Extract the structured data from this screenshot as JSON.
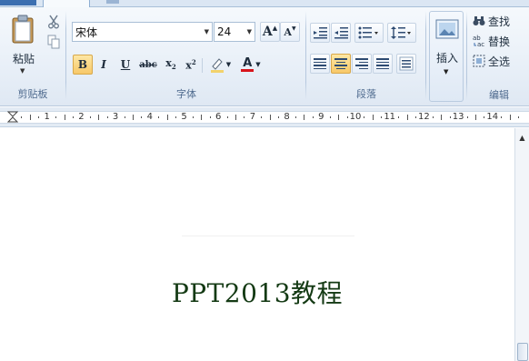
{
  "clipboard": {
    "paste_label": "粘贴",
    "group_label": "剪贴板",
    "icons": [
      "clipboard-icon",
      "scissors-icon",
      "copy-icon"
    ]
  },
  "font": {
    "name_value": "宋体",
    "size_value": "24",
    "grow_label": "A",
    "shrink_label": "A",
    "bold_label": "B",
    "italic_label": "I",
    "underline_label": "U",
    "strike_label": "abc",
    "subscript_label": "x",
    "superscript_label": "x",
    "sub_marker": "2",
    "sup_marker": "2",
    "color_label": "A",
    "group_label": "字体",
    "highlight_color": "#f2d26b",
    "font_color": "#d8141b"
  },
  "paragraph": {
    "group_label": "段落"
  },
  "insert": {
    "label": "插入"
  },
  "editing": {
    "find_label": "查找",
    "replace_label": "替换",
    "select_all_label": "全选",
    "group_label": "编辑"
  },
  "ruler": {
    "numbers": [
      "1",
      "2",
      "3",
      "4",
      "5",
      "6",
      "7",
      "8",
      "9",
      "10",
      "11",
      "12",
      "13",
      "14"
    ]
  },
  "document": {
    "title_text": "PPT2013教程"
  },
  "colors": {
    "active_button": "#f7c868",
    "group_label": "#4e6a8e",
    "document_text": "#143a14"
  }
}
